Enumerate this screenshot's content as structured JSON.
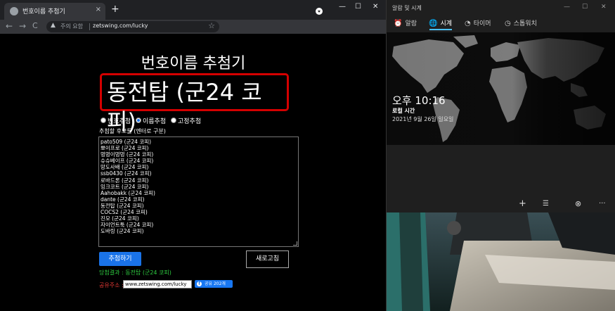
{
  "browser": {
    "tab_title": "번호이름 추첨기",
    "tab_close": "×",
    "new_tab": "+",
    "window_buttons": [
      "—",
      "☐",
      "✕"
    ],
    "nav": {
      "back": "←",
      "forward": "→",
      "reload": "C"
    },
    "omnibox": {
      "warning_icon": "▲",
      "warning_text": "주의 요함",
      "url": "zetswing.com/lucky",
      "star": "☆"
    }
  },
  "page": {
    "title": "번호이름 추첨기",
    "result_display": "동전탑 (군24 코피)",
    "modes": [
      {
        "label": "번호추첨",
        "checked": false
      },
      {
        "label": "이름추첨",
        "checked": true
      },
      {
        "label": "고정추첨",
        "checked": false
      }
    ],
    "candidates_label": "추첨할 후보들 (엔터로 구분)",
    "candidates": [
      "pato509 (군24 코피)",
      "뽀이프로 (군24 코피)",
      "멍멍이멍멍 (군24 코피)",
      "슈슈베이프 (군24 코피)",
      "망도사배 (군24 코피)",
      "ssb0430 (군24 코피)",
      "로바드론 (군24 코피)",
      "잉크코트 (군24 코피)",
      "Aahobakk (군24 코피)",
      "dante (군24 코피)",
      "동전탑 (군24 코피)",
      "COCS2 (군24 코피)",
      "진모 (군24 코피)",
      "자이언트툭 (군24 코피)",
      "도바링 (군24 코피)"
    ],
    "draw_button": "추첨하기",
    "refresh_button": "새로고침",
    "result_line": "당첨결과 : 동전탑 (군24 코피)",
    "share_label": "공유주소 :",
    "share_url": "www.zetswing.com/lucky",
    "share_button": "공유 202개",
    "facebook_icon": "f"
  },
  "clock_app": {
    "title": "알람 및 시계",
    "window_buttons": [
      "—",
      "☐",
      "✕"
    ],
    "tabs": [
      {
        "icon": "alarm-icon",
        "glyph": "⏰",
        "label": "알람"
      },
      {
        "icon": "world-clock-icon",
        "glyph": "🌐",
        "label": "시계"
      },
      {
        "icon": "timer-icon",
        "glyph": "◔",
        "label": "타이머"
      },
      {
        "icon": "stopwatch-icon",
        "glyph": "◷",
        "label": "스톱워치"
      }
    ],
    "active_tab": "시계",
    "time": "오후 10:16",
    "location": "로컬 시간",
    "date": "2021년 9월 26일 일요일",
    "bottom_icons": {
      "add": "+",
      "edit": "☰",
      "compare": "⊗",
      "more": "···"
    }
  },
  "colors": {
    "accent": "#4cc2ff",
    "highlight_border": "#d40000",
    "primary_button": "#1a73e8",
    "result_text": "#2ecc40",
    "share_label": "#e53935",
    "facebook": "#1877f2"
  }
}
